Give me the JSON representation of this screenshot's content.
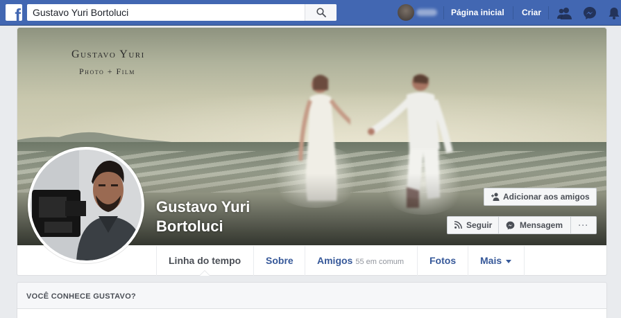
{
  "topbar": {
    "search_value": "Gustavo Yuri Bortoluci",
    "home_label": "Página inicial",
    "create_label": "Criar",
    "icons": [
      "facebook-logo",
      "search-icon",
      "friend-requests-icon",
      "messenger-icon",
      "notifications-icon"
    ],
    "brand_color": "#4267b2"
  },
  "cover": {
    "brand_line1": "Gustavo Yuri",
    "brand_line2": "Photo + Film"
  },
  "profile": {
    "name": "Gustavo Yuri Bortoluci"
  },
  "actions": {
    "add_friend_label": "Adicionar aos amigos",
    "follow_label": "Seguir",
    "message_label": "Mensagem",
    "more_label": "···"
  },
  "tabs": [
    {
      "label": "Linha do tempo",
      "active": true
    },
    {
      "label": "Sobre"
    },
    {
      "label": "Amigos",
      "sublabel": "55 em comum"
    },
    {
      "label": "Fotos"
    },
    {
      "label": "Mais"
    }
  ],
  "know_card": {
    "title": "VOCÊ CONHECE GUSTAVO?"
  }
}
